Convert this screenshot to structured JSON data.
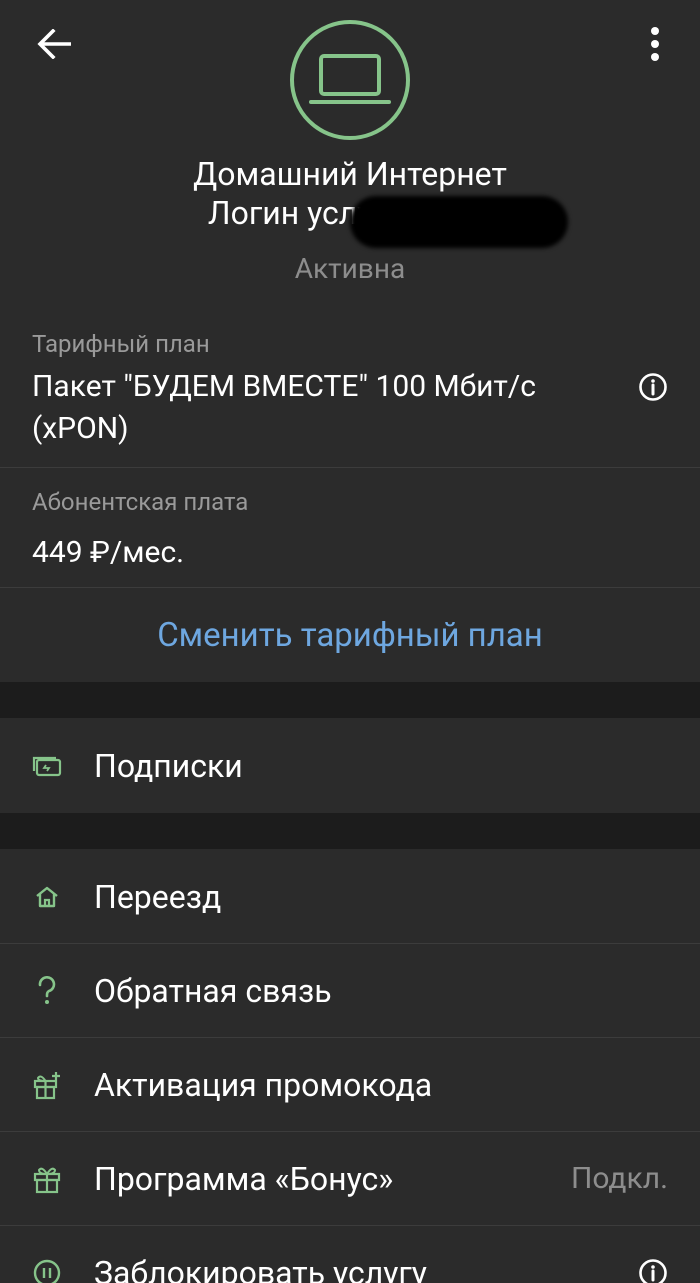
{
  "header": {
    "back_icon": "arrow-left-icon",
    "menu_icon": "more-vert-icon",
    "avatar_icon": "laptop-icon",
    "title": "Домашний Интернет",
    "login_label": "Логин услуги:",
    "status": "Активна"
  },
  "tariff": {
    "label": "Тарифный план",
    "value": "Пакет \"БУДЕМ ВМЕСТЕ\" 100 Мбит/с (xPON)"
  },
  "fee": {
    "label": "Абонентская плата",
    "value": "449 ₽/мес."
  },
  "change_plan": "Сменить тарифный план",
  "subscriptions": {
    "label": "Подписки",
    "icon": "subscription-card-icon"
  },
  "menu": [
    {
      "label": "Переезд",
      "icon": "home-icon"
    },
    {
      "label": "Обратная связь",
      "icon": "question-icon"
    },
    {
      "label": "Активация промокода",
      "icon": "gift-plus-icon"
    },
    {
      "label": "Программа «Бонус»",
      "icon": "gift-icon",
      "right_text": "Подкл."
    },
    {
      "label": "Заблокировать услугу",
      "icon": "pause-icon"
    }
  ],
  "colors": {
    "accent_green": "#86c48a",
    "link_blue": "#6ea7e0",
    "background": "#2b2b2b"
  }
}
